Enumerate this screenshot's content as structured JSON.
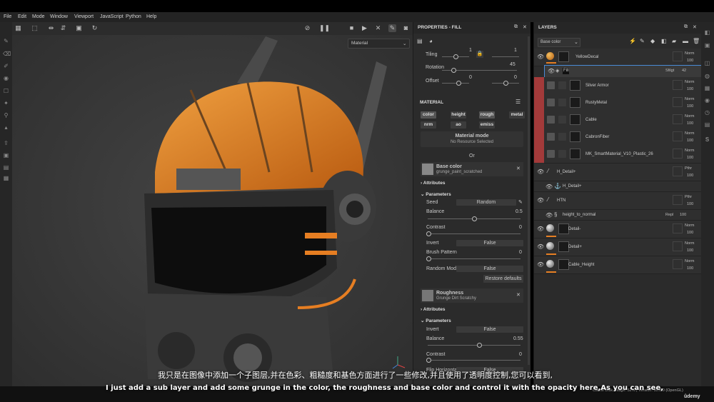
{
  "menu": [
    "File",
    "Edit",
    "Mode",
    "Window",
    "Viewport",
    "JavaScript",
    "Python",
    "Help"
  ],
  "viewport": {
    "dropdown": "Material"
  },
  "properties": {
    "title": "PROPERTIES - FILL",
    "tiling_label": "Tiling",
    "tiling_val1": "1",
    "tiling_val2": "1",
    "rotation_label": "Rotation",
    "rotation_val": "45",
    "offset_label": "Offset",
    "offset_val1": "0",
    "offset_val2": "0",
    "material_section": "MATERIAL",
    "channels": [
      "color",
      "height",
      "rough",
      "metal",
      "nrm",
      "ao",
      "emiss"
    ],
    "material_mode": "Material mode",
    "no_resource": "No Resource Selected",
    "or": "Or",
    "base_color": {
      "title": "Base color",
      "resource": "grunge_paint_scratched"
    },
    "attributes": "Attributes",
    "parameters": "Parameters",
    "seed_label": "Seed",
    "seed_value": "Random",
    "balance_label": "Balance",
    "balance_value": "0.5",
    "contrast_label": "Contrast",
    "contrast_value": "0",
    "invert_label": "Invert",
    "invert_value": "False",
    "brush_label": "Brush Pattern",
    "brush_value": "0",
    "random_label": "Random Mode",
    "random_value": "False",
    "restore": "Restore defaults",
    "roughness": {
      "title": "Roughness",
      "resource": "Grunge Dirt Scratchy"
    },
    "attributes2": "Attributes",
    "parameters2": "Parameters",
    "invert2_label": "Invert",
    "invert2_value": "False",
    "balance2_label": "Balance",
    "balance2_value": "0.55",
    "contrast2_label": "Contrast",
    "contrast2_value": "0",
    "flip_label": "Flip Horizontal",
    "flip_value": "False"
  },
  "layers": {
    "title": "LAYERS",
    "channel": "Base color",
    "items": [
      {
        "name": "YellowDecal",
        "blend": "Norm",
        "opacity": "100"
      },
      {
        "name": "Fill",
        "blend": "Sfilgt",
        "opacity": "42"
      },
      {
        "name": "Silver Armor",
        "blend": "Norm",
        "opacity": "100"
      },
      {
        "name": "RustyMetal",
        "blend": "Norm",
        "opacity": "100"
      },
      {
        "name": "Cable",
        "blend": "Norm",
        "opacity": "100"
      },
      {
        "name": "CabronFiber",
        "blend": "Norm",
        "opacity": "100"
      },
      {
        "name": "MK_SmartMaterial_V10_Plastic_26",
        "blend": "Norm",
        "opacity": "100"
      },
      {
        "name": "H_Detail+",
        "blend": "Pthr",
        "opacity": "100"
      },
      {
        "name": "H_Detail+",
        "blend": "",
        "opacity": ""
      },
      {
        "name": "HTN",
        "blend": "Pthr",
        "opacity": "100"
      },
      {
        "name": "height_to_normal",
        "blend": "Repl",
        "opacity": "100"
      },
      {
        "name": "Detail-",
        "blend": "Norm",
        "opacity": "100"
      },
      {
        "name": "Detail+",
        "blend": "Norm",
        "opacity": "100"
      },
      {
        "name": "Cable_Height",
        "blend": "Norm",
        "opacity": "100"
      }
    ]
  },
  "status": {
    "text": "Cache Disk Usage:  52%  |  Version: 10.0.0 (OpenGL)",
    "brand": "ûdemy"
  },
  "subtitles": {
    "zh": "我只是在图像中添加一个子图层,并在色彩、粗糙度和基色方面进行了一些修改,并且使用了透明度控制,您可以看到,",
    "en": "I just add a sub layer and add some grunge in the color, the roughness and base color and control it with the opacity here,As you can see,"
  },
  "colors": {
    "accent": "#e67e22",
    "panel": "#2b2b2b",
    "layer_red": "#a33a3a"
  }
}
